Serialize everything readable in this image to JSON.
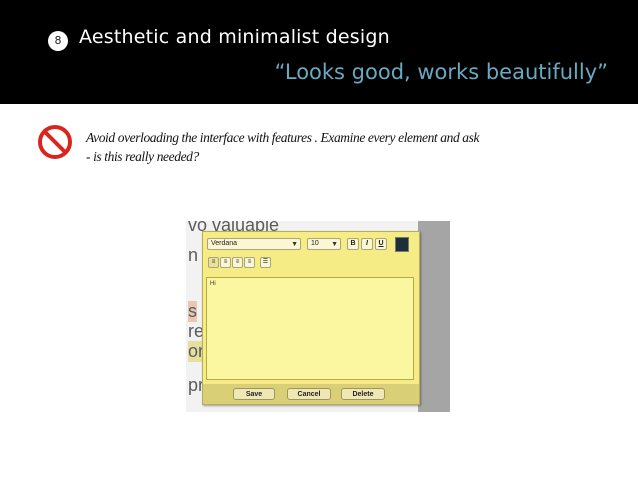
{
  "slide": {
    "number": "8",
    "title": "Aesthetic and minimalist design",
    "subtitle": "“Looks good, works beautifully”"
  },
  "body": {
    "icon": "prohibition-icon",
    "line1": "Avoid overloading the interface with features . Examine every element and ask",
    "line2": "- is this really needed?"
  },
  "screenshot": {
    "background_text": [
      "vo valuable",
      "n",
      "s",
      "re",
      "or",
      "pr"
    ],
    "font_select": "Verdana",
    "size_select": "10",
    "format_buttons": [
      "B",
      "I",
      "U"
    ],
    "align_buttons": [
      "≡",
      "≡",
      "≡",
      "≡",
      "☰"
    ],
    "text_content": "Hi",
    "actions": {
      "save": "Save",
      "cancel": "Cancel",
      "delete": "Delete"
    },
    "colors": {
      "editor_bg": "#f5ec86",
      "swatch": "#1c2e3a",
      "header_bg": "#000000",
      "subtitle": "#6aa9c2"
    }
  }
}
